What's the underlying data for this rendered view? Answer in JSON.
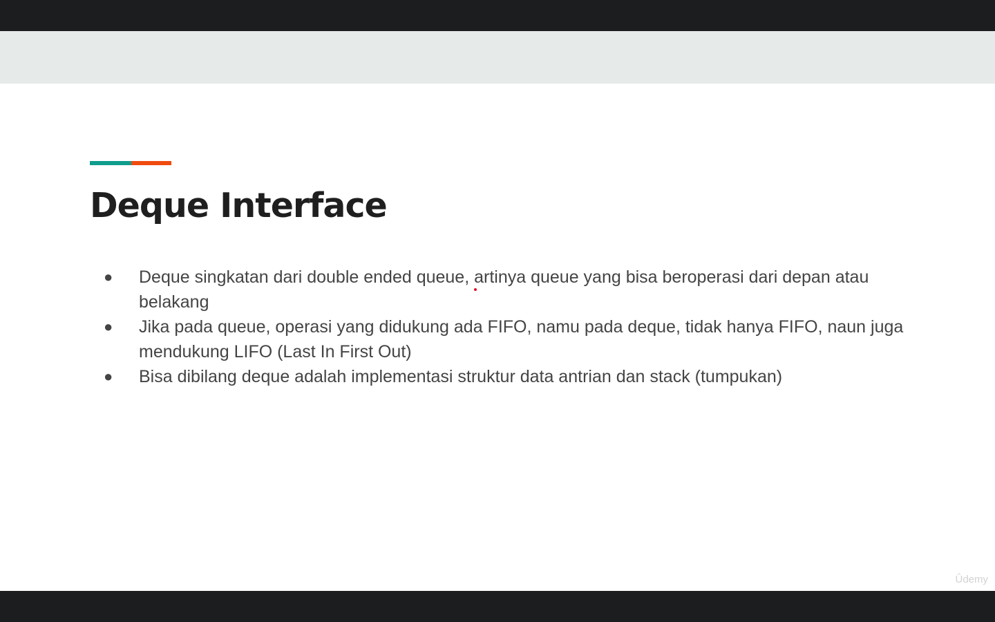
{
  "slide": {
    "title": "Deque Interface",
    "bullets": [
      "Deque singkatan dari double ended queue, artinya queue yang bisa beroperasi dari depan atau belakang",
      "Jika pada queue, operasi yang didukung ada FIFO, namu pada deque, tidak hanya FIFO, naun juga mendukung LIFO (Last In First Out)",
      "Bisa dibilang deque adalah implementasi struktur data antrian dan stack (tumpukan)"
    ],
    "bullet_symbol": "●",
    "watermark": "Ûdemy"
  },
  "colors": {
    "accent_teal": "#0f9d8c",
    "accent_orange": "#ef4b0f",
    "header_band": "#e6ebea",
    "letterbox": "#1c1d1f"
  }
}
